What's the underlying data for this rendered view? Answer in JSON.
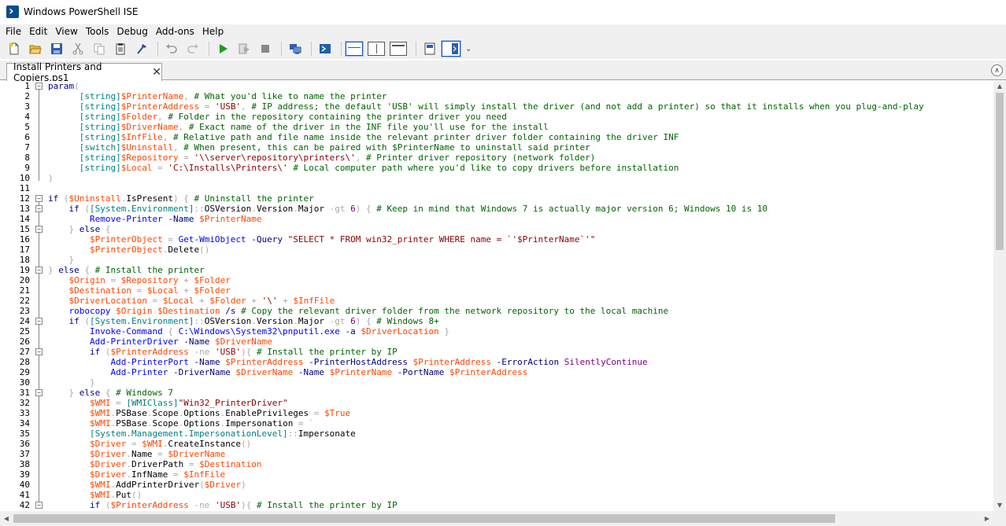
{
  "window": {
    "title": "Windows PowerShell ISE"
  },
  "menu": [
    "File",
    "Edit",
    "View",
    "Tools",
    "Debug",
    "Add-ons",
    "Help"
  ],
  "toolbar": {
    "buttons": [
      "new-icon",
      "open-icon",
      "save-icon",
      "cut-icon",
      "copy-icon",
      "paste-icon",
      "clear-icon",
      "undo-icon",
      "redo-icon",
      "run-icon",
      "run-selection-icon",
      "stop-icon",
      "remote-icon",
      "console-icon",
      "pane-top-icon",
      "pane-right-icon",
      "pane-max-icon",
      "show-command-icon",
      "show-addon-icon"
    ],
    "more": "⌄"
  },
  "tab": {
    "label": "Install Printers and Copiers.ps1",
    "close": "✕"
  },
  "editor": {
    "lines": [
      [
        [
          "kw",
          "param"
        ],
        [
          "op",
          "("
        ]
      ],
      [
        [
          "",
          "      "
        ],
        [
          "ty",
          "[string]"
        ],
        [
          "var",
          "$PrinterName"
        ],
        [
          "op",
          ", "
        ],
        [
          "cm",
          "# What you'd like to name the printer"
        ]
      ],
      [
        [
          "",
          "      "
        ],
        [
          "ty",
          "[string]"
        ],
        [
          "var",
          "$PrinterAddress"
        ],
        [
          "op",
          " = "
        ],
        [
          "st",
          "'USB'"
        ],
        [
          "op",
          ", "
        ],
        [
          "cm",
          "# IP address; the default 'USB' will simply install the driver (and not add a printer) so that it installs when you plug-and-play"
        ]
      ],
      [
        [
          "",
          "      "
        ],
        [
          "ty",
          "[string]"
        ],
        [
          "var",
          "$Folder"
        ],
        [
          "op",
          ", "
        ],
        [
          "cm",
          "# Folder in the repository containing the printer driver you need"
        ]
      ],
      [
        [
          "",
          "      "
        ],
        [
          "ty",
          "[string]"
        ],
        [
          "var",
          "$DriverName"
        ],
        [
          "op",
          ", "
        ],
        [
          "cm",
          "# Exact name of the driver in the INF file you'll use for the install"
        ]
      ],
      [
        [
          "",
          "      "
        ],
        [
          "ty",
          "[string]"
        ],
        [
          "var",
          "$InfFile"
        ],
        [
          "op",
          ", "
        ],
        [
          "cm",
          "# Relative path and file name inside the relevant printer driver folder containing the driver INF"
        ]
      ],
      [
        [
          "",
          "      "
        ],
        [
          "ty",
          "[switch]"
        ],
        [
          "var",
          "$Uninstall"
        ],
        [
          "op",
          ", "
        ],
        [
          "cm",
          "# When present, this can be paired with $PrinterName to uninstall said printer"
        ]
      ],
      [
        [
          "",
          "      "
        ],
        [
          "ty",
          "[string]"
        ],
        [
          "var",
          "$Repository"
        ],
        [
          "op",
          " = "
        ],
        [
          "st",
          "'\\\\server\\repository\\printers\\'"
        ],
        [
          "op",
          ", "
        ],
        [
          "cm",
          "# Printer driver repository (network folder)"
        ]
      ],
      [
        [
          "",
          "      "
        ],
        [
          "ty",
          "[string]"
        ],
        [
          "var",
          "$Local"
        ],
        [
          "op",
          " = "
        ],
        [
          "st",
          "'C:\\Installs\\Printers\\'"
        ],
        [
          "op",
          " "
        ],
        [
          "cm",
          "# Local computer path where you'd like to copy drivers before installation"
        ]
      ],
      [
        [
          "op",
          ")"
        ]
      ],
      [
        [
          "",
          ""
        ]
      ],
      [
        [
          "kw",
          "if"
        ],
        [
          "op",
          " ("
        ],
        [
          "var",
          "$Uninstall"
        ],
        [
          "op",
          "."
        ],
        [
          "mem",
          "IsPresent"
        ],
        [
          "op",
          ") { "
        ],
        [
          "cm",
          "# Uninstall the printer"
        ]
      ],
      [
        [
          "",
          "    "
        ],
        [
          "kw",
          "if"
        ],
        [
          "op",
          " ("
        ],
        [
          "ty",
          "[System.Environment]"
        ],
        [
          "op",
          "::"
        ],
        [
          "mem",
          "OSVersion"
        ],
        [
          "op",
          "."
        ],
        [
          "mem",
          "Version"
        ],
        [
          "op",
          "."
        ],
        [
          "mem",
          "Major"
        ],
        [
          "op",
          " -gt "
        ],
        [
          "num",
          "6"
        ],
        [
          "op",
          ") { "
        ],
        [
          "cm",
          "# Keep in mind that Windows 7 is actually major version 6; Windows 10 is 10"
        ]
      ],
      [
        [
          "",
          "        "
        ],
        [
          "cmd",
          "Remove-Printer"
        ],
        [
          "op",
          " "
        ],
        [
          "par",
          "-Name"
        ],
        [
          "op",
          " "
        ],
        [
          "var",
          "$PrinterName"
        ]
      ],
      [
        [
          "",
          "    "
        ],
        [
          "op",
          "} "
        ],
        [
          "kw",
          "else"
        ],
        [
          "op",
          " {"
        ]
      ],
      [
        [
          "",
          "        "
        ],
        [
          "var",
          "$PrinterObject"
        ],
        [
          "op",
          " = "
        ],
        [
          "cmd",
          "Get-WmiObject"
        ],
        [
          "op",
          " "
        ],
        [
          "par",
          "-Query"
        ],
        [
          "op",
          " "
        ],
        [
          "st",
          "\"SELECT * FROM win32_printer WHERE name = `'$PrinterName`'\""
        ]
      ],
      [
        [
          "",
          "        "
        ],
        [
          "var",
          "$PrinterObject"
        ],
        [
          "op",
          "."
        ],
        [
          "mem",
          "Delete"
        ],
        [
          "op",
          "()"
        ]
      ],
      [
        [
          "",
          "    "
        ],
        [
          "op",
          "}"
        ]
      ],
      [
        [
          "op",
          "} "
        ],
        [
          "kw",
          "else"
        ],
        [
          "op",
          " { "
        ],
        [
          "cm",
          "# Install the printer"
        ]
      ],
      [
        [
          "",
          "    "
        ],
        [
          "var",
          "$Origin"
        ],
        [
          "op",
          " = "
        ],
        [
          "var",
          "$Repository"
        ],
        [
          "op",
          " + "
        ],
        [
          "var",
          "$Folder"
        ]
      ],
      [
        [
          "",
          "    "
        ],
        [
          "var",
          "$Destination"
        ],
        [
          "op",
          " = "
        ],
        [
          "var",
          "$Local"
        ],
        [
          "op",
          " + "
        ],
        [
          "var",
          "$Folder"
        ]
      ],
      [
        [
          "",
          "    "
        ],
        [
          "var",
          "$DriverLocation"
        ],
        [
          "op",
          " = "
        ],
        [
          "var",
          "$Local"
        ],
        [
          "op",
          " + "
        ],
        [
          "var",
          "$Folder"
        ],
        [
          "op",
          " + "
        ],
        [
          "st",
          "'\\'"
        ],
        [
          "op",
          " + "
        ],
        [
          "var",
          "$InfFile"
        ]
      ],
      [
        [
          "",
          "    "
        ],
        [
          "cmd",
          "robocopy"
        ],
        [
          "op",
          " "
        ],
        [
          "var",
          "$Origin"
        ],
        [
          "op",
          " "
        ],
        [
          "var",
          "$Destination"
        ],
        [
          "op",
          " "
        ],
        [
          "par",
          "/s"
        ],
        [
          "op",
          " "
        ],
        [
          "cm",
          "# Copy the relevant driver folder from the network repository to the local machine"
        ]
      ],
      [
        [
          "",
          "    "
        ],
        [
          "kw",
          "if"
        ],
        [
          "op",
          " ("
        ],
        [
          "ty",
          "[System.Environment]"
        ],
        [
          "op",
          "::"
        ],
        [
          "mem",
          "OSVersion"
        ],
        [
          "op",
          "."
        ],
        [
          "mem",
          "Version"
        ],
        [
          "op",
          "."
        ],
        [
          "mem",
          "Major"
        ],
        [
          "op",
          " -gt "
        ],
        [
          "num",
          "6"
        ],
        [
          "op",
          ") { "
        ],
        [
          "cm",
          "# Windows 8+"
        ]
      ],
      [
        [
          "",
          "        "
        ],
        [
          "cmd",
          "Invoke-Command"
        ],
        [
          "op",
          " { "
        ],
        [
          "cmd",
          "C:\\Windows\\System32\\pnputil.exe"
        ],
        [
          "op",
          " "
        ],
        [
          "par",
          "-a"
        ],
        [
          "op",
          " "
        ],
        [
          "var",
          "$DriverLocation"
        ],
        [
          "op",
          " }"
        ]
      ],
      [
        [
          "",
          "        "
        ],
        [
          "cmd",
          "Add-PrinterDriver"
        ],
        [
          "op",
          " "
        ],
        [
          "par",
          "-Name"
        ],
        [
          "op",
          " "
        ],
        [
          "var",
          "$DriverName"
        ]
      ],
      [
        [
          "",
          "        "
        ],
        [
          "kw",
          "if"
        ],
        [
          "op",
          " ("
        ],
        [
          "var",
          "$PrinterAddress"
        ],
        [
          "op",
          " -ne "
        ],
        [
          "st",
          "'USB'"
        ],
        [
          "op",
          "){ "
        ],
        [
          "cm",
          "# Install the printer by IP"
        ]
      ],
      [
        [
          "",
          "            "
        ],
        [
          "cmd",
          "Add-PrinterPort"
        ],
        [
          "op",
          " "
        ],
        [
          "par",
          "-Name"
        ],
        [
          "op",
          " "
        ],
        [
          "var",
          "$PrinterAddress"
        ],
        [
          "op",
          " "
        ],
        [
          "par",
          "-PrinterHostAddress"
        ],
        [
          "op",
          " "
        ],
        [
          "var",
          "$PrinterAddress"
        ],
        [
          "op",
          " "
        ],
        [
          "par",
          "-ErrorAction"
        ],
        [
          "op",
          " "
        ],
        [
          "num",
          "SilentlyContinue"
        ]
      ],
      [
        [
          "",
          "            "
        ],
        [
          "cmd",
          "Add-Printer"
        ],
        [
          "op",
          " "
        ],
        [
          "par",
          "-DriverName"
        ],
        [
          "op",
          " "
        ],
        [
          "var",
          "$DriverName"
        ],
        [
          "op",
          " "
        ],
        [
          "par",
          "-Name"
        ],
        [
          "op",
          " "
        ],
        [
          "var",
          "$PrinterName"
        ],
        [
          "op",
          " "
        ],
        [
          "par",
          "-PortName"
        ],
        [
          "op",
          " "
        ],
        [
          "var",
          "$PrinterAddress"
        ]
      ],
      [
        [
          "",
          "        "
        ],
        [
          "op",
          "}"
        ]
      ],
      [
        [
          "",
          "    "
        ],
        [
          "op",
          "} "
        ],
        [
          "kw",
          "else"
        ],
        [
          "op",
          " { "
        ],
        [
          "cm",
          "# Windows 7"
        ]
      ],
      [
        [
          "",
          "        "
        ],
        [
          "var",
          "$WMI"
        ],
        [
          "op",
          " = "
        ],
        [
          "ty",
          "[WMIClass]"
        ],
        [
          "st",
          "\"Win32_PrinterDriver\""
        ]
      ],
      [
        [
          "",
          "        "
        ],
        [
          "var",
          "$WMI"
        ],
        [
          "op",
          "."
        ],
        [
          "mem",
          "PSBase"
        ],
        [
          "op",
          "."
        ],
        [
          "mem",
          "Scope"
        ],
        [
          "op",
          "."
        ],
        [
          "mem",
          "Options"
        ],
        [
          "op",
          "."
        ],
        [
          "mem",
          "EnablePrivileges"
        ],
        [
          "op",
          " = "
        ],
        [
          "var",
          "$True"
        ]
      ],
      [
        [
          "",
          "        "
        ],
        [
          "var",
          "$WMI"
        ],
        [
          "op",
          "."
        ],
        [
          "mem",
          "PSBase"
        ],
        [
          "op",
          "."
        ],
        [
          "mem",
          "Scope"
        ],
        [
          "op",
          "."
        ],
        [
          "mem",
          "Options"
        ],
        [
          "op",
          "."
        ],
        [
          "mem",
          "Impersonation"
        ],
        [
          "op",
          " = `"
        ]
      ],
      [
        [
          "",
          "        "
        ],
        [
          "ty",
          "[System.Management.ImpersonationLevel]"
        ],
        [
          "op",
          "::"
        ],
        [
          "mem",
          "Impersonate"
        ]
      ],
      [
        [
          "",
          "        "
        ],
        [
          "var",
          "$Driver"
        ],
        [
          "op",
          " = "
        ],
        [
          "var",
          "$WMI"
        ],
        [
          "op",
          "."
        ],
        [
          "mem",
          "CreateInstance"
        ],
        [
          "op",
          "()"
        ]
      ],
      [
        [
          "",
          "        "
        ],
        [
          "var",
          "$Driver"
        ],
        [
          "op",
          "."
        ],
        [
          "mem",
          "Name"
        ],
        [
          "op",
          " = "
        ],
        [
          "var",
          "$DriverName"
        ]
      ],
      [
        [
          "",
          "        "
        ],
        [
          "var",
          "$Driver"
        ],
        [
          "op",
          "."
        ],
        [
          "mem",
          "DriverPath"
        ],
        [
          "op",
          " = "
        ],
        [
          "var",
          "$Destination"
        ]
      ],
      [
        [
          "",
          "        "
        ],
        [
          "var",
          "$Driver"
        ],
        [
          "op",
          "."
        ],
        [
          "mem",
          "InfName"
        ],
        [
          "op",
          " = "
        ],
        [
          "var",
          "$InfFile"
        ]
      ],
      [
        [
          "",
          "        "
        ],
        [
          "var",
          "$WMI"
        ],
        [
          "op",
          "."
        ],
        [
          "mem",
          "AddPrinterDriver"
        ],
        [
          "op",
          "("
        ],
        [
          "var",
          "$Driver"
        ],
        [
          "op",
          ")"
        ]
      ],
      [
        [
          "",
          "        "
        ],
        [
          "var",
          "$WMI"
        ],
        [
          "op",
          "."
        ],
        [
          "mem",
          "Put"
        ],
        [
          "op",
          "()"
        ]
      ],
      [
        [
          "",
          "        "
        ],
        [
          "kw",
          "if"
        ],
        [
          "op",
          " ("
        ],
        [
          "var",
          "$PrinterAddress"
        ],
        [
          "op",
          " -ne "
        ],
        [
          "st",
          "'USB'"
        ],
        [
          "op",
          "){ "
        ],
        [
          "cm",
          "# Install the printer by IP"
        ]
      ]
    ]
  }
}
